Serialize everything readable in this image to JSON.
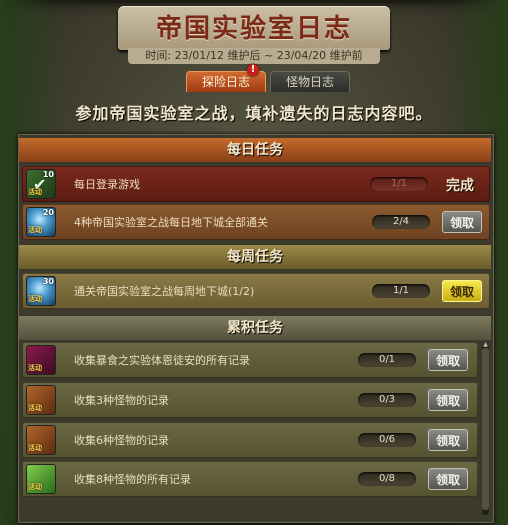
{
  "window": {
    "title": "帝国实验室日志",
    "date_line": "时间: 23/01/12 维护后 ~ 23/04/20 维护前"
  },
  "tabs": [
    {
      "label": "探险日志",
      "active": true,
      "alert": "!"
    },
    {
      "label": "怪物日志",
      "active": false
    }
  ],
  "subtitle": "参加帝国实验室之战，填补遗失的日志内容吧。",
  "sections": {
    "daily": {
      "title": "每日任务",
      "rows": [
        {
          "text": "每日登录游戏",
          "progress": "1/1",
          "status": "完成",
          "icon": "check-icon",
          "icon_num": "10",
          "icon_tag": "活动"
        },
        {
          "text": "4种帝国实验室之战每日地下城全部通关",
          "progress": "2/4",
          "button": "领取",
          "icon": "crystal-icon",
          "icon_num": "20",
          "icon_tag": "活动"
        }
      ]
    },
    "weekly": {
      "title": "每周任务",
      "rows": [
        {
          "text": "通关帝国实验室之战每周地下城(1/2)",
          "progress": "1/1",
          "button": "领取",
          "icon": "crystal-icon",
          "icon_num": "30",
          "icon_tag": "活动"
        }
      ]
    },
    "accumulated": {
      "title": "累积任务",
      "rows": [
        {
          "text": "收集暴食之实验体恩徒安的所有记录",
          "progress": "0/1",
          "button": "领取",
          "icon": "monster-card-icon",
          "icon_tag": "活动"
        },
        {
          "text": "收集3种怪物的记录",
          "progress": "0/3",
          "button": "领取",
          "icon": "monster-card-icon",
          "icon_tag": "活动"
        },
        {
          "text": "收集6种怪物的记录",
          "progress": "0/6",
          "button": "领取",
          "icon": "monster-card-icon",
          "icon_tag": "活动"
        },
        {
          "text": "收集8种怪物的所有记录",
          "progress": "0/8",
          "button": "领取",
          "icon": "green-cube-icon",
          "icon_tag": "活动"
        }
      ]
    }
  },
  "colors": {
    "title_text": "#7a2a16",
    "daily_header": "#c46b2c",
    "weekly_header": "#9c8a4a",
    "accumulated_header": "#7d7a5f",
    "claim_active": "#f6e84e"
  }
}
